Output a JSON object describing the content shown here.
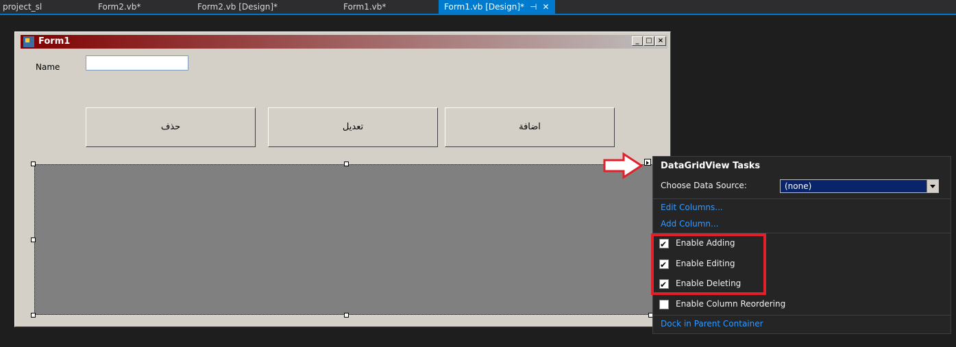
{
  "tabs": [
    {
      "label": "project_sl"
    },
    {
      "label": "Form2.vb*"
    },
    {
      "label": "Form2.vb [Design]*"
    },
    {
      "label": "Form1.vb*"
    },
    {
      "label": "Form1.vb [Design]*",
      "pin": "⊣",
      "close": "✕"
    }
  ],
  "form": {
    "title": "Form1",
    "name_label": "Name",
    "name_value": "",
    "buttons": {
      "delete": "حذف",
      "edit": "تعديل",
      "add": "اضافة"
    },
    "window_buttons": {
      "minimize": "_",
      "maximize": "□",
      "close": "×"
    }
  },
  "tasks_panel": {
    "title": "DataGridView Tasks",
    "datasource_label": "Choose Data Source:",
    "datasource_value": "(none)",
    "edit_columns": "Edit Columns...",
    "add_column": "Add Column...",
    "options": [
      {
        "label": "Enable Adding",
        "checked": true
      },
      {
        "label": "Enable Editing",
        "checked": true
      },
      {
        "label": "Enable Deleting",
        "checked": true
      },
      {
        "label": "Enable Column Reordering",
        "checked": false
      }
    ],
    "dock": "Dock in Parent Container"
  },
  "colors": {
    "accent": "#007acc",
    "highlight": "#e3202a",
    "link": "#3399ff"
  }
}
